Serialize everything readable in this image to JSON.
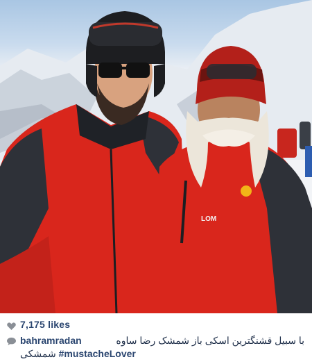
{
  "post": {
    "likes": "7,175 likes",
    "username": "bahramradan",
    "caption_line1": "با سبیل قشنگترین اسکی باز شمشک رضا ساوه",
    "caption_line2_fa": "شمشکی",
    "hashtag": "#mustacheLover"
  },
  "icons": {
    "likes": "heart-icon",
    "caption": "comment-icon"
  },
  "colors": {
    "username": "#2b4670",
    "jacket_red": "#d9261c",
    "icon_gray": "#8a8f96"
  }
}
